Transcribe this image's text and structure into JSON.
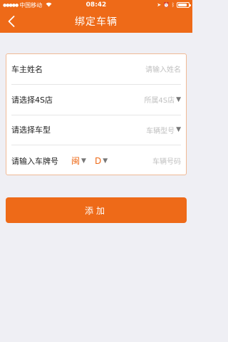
{
  "status_bar": {
    "carrier": "中国移动",
    "time": "08:42",
    "battery_level": 0.85
  },
  "nav": {
    "title": "绑定车辆"
  },
  "form": {
    "owner_name": {
      "label": "车主姓名",
      "placeholder": "请输入姓名"
    },
    "store": {
      "label": "请选择4S店",
      "value": "所属4S店"
    },
    "model": {
      "label": "请选择车型",
      "value": "车辆型号"
    },
    "plate": {
      "label": "请输入车牌号",
      "province": "闽",
      "letter": "D",
      "placeholder": "车辆号码"
    }
  },
  "actions": {
    "add_label": "添加"
  },
  "colors": {
    "accent": "#ee6a18",
    "background": "#efeff4",
    "placeholder": "#c0c0c0"
  },
  "icons": [
    "signal-icon",
    "wifi-icon",
    "location-icon",
    "alarm-icon",
    "bluetooth-icon",
    "battery-icon",
    "back-icon",
    "caret-down-icon"
  ]
}
